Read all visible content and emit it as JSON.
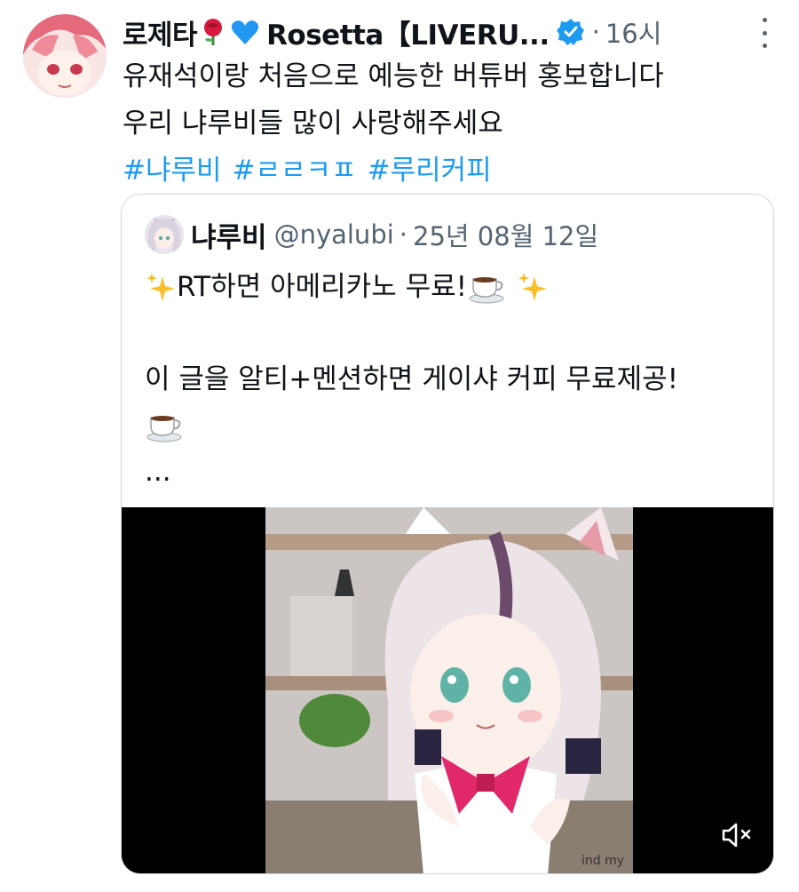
{
  "tweet": {
    "display_name_prefix": "로제타",
    "display_name": "Rosetta【LIVERU...",
    "separator": "·",
    "time": "16시",
    "text_lines": [
      "유재석이랑 처음으로 예능한 버튜버 홍보합니다",
      "우리 냐루비들 많이 사랑해주세요"
    ],
    "hashtags": [
      "#냐루비",
      "#ㄹㄹㅋㅍ",
      "#루리커피"
    ],
    "icons": {
      "name_emoji_1": "rose-emoji",
      "name_emoji_2": "blue-heart-emoji",
      "verified": "verified-badge-icon",
      "more": "more-icon"
    }
  },
  "quote": {
    "name": "냐루비",
    "handle": "@nyalubi",
    "separator": "·",
    "date": "25년 08월 12일",
    "line1_text": "RT하면 아메리카노 무료!",
    "line2_text": "이 글을 알티+멘션하면 게이샤 커피 무료제공!",
    "ellipsis": "...",
    "media_caption": "ind my",
    "icons": {
      "sparkles": "sparkles-emoji",
      "coffee": "coffee-cup-emoji",
      "mute": "volume-muted-icon"
    }
  },
  "colors": {
    "link": "#1d9bf0",
    "verified": "#1d9bf0",
    "muted_text": "#536471",
    "border": "#cfd9de"
  }
}
